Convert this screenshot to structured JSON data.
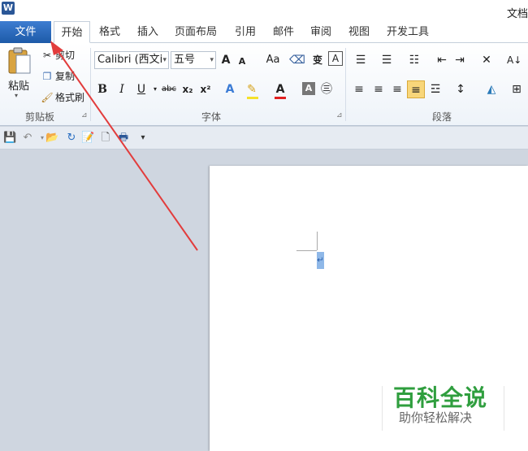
{
  "window": {
    "app_icon": "W",
    "title_partial": "文档"
  },
  "tabs": [
    "文件",
    "开始",
    "格式",
    "插入",
    "页面布局",
    "引用",
    "邮件",
    "审阅",
    "视图",
    "开发工具"
  ],
  "clipboard": {
    "paste": "粘贴",
    "cut": "剪切",
    "copy": "复制",
    "format_painter": "格式刷",
    "label": "剪贴板"
  },
  "font": {
    "name": "Calibri (西文i",
    "size": "五号",
    "label": "字体",
    "grow": "A",
    "shrink": "A",
    "case": "Aa",
    "bold": "B",
    "italic": "I",
    "underline": "U",
    "strike": "abc",
    "sub": "x₂",
    "sup": "x²",
    "color_a": "A",
    "highlight_a": "A"
  },
  "paragraph": {
    "label": "段落"
  },
  "watermark": {
    "title": "百科全说",
    "subtitle": "助你轻松解决"
  },
  "colors": {
    "file_tab": "#2b5eb3",
    "arrow": "#e23c3c",
    "watermark_green": "#2f9e3e"
  },
  "icons": [
    "word-icon",
    "paste-icon",
    "cut-icon",
    "copy-icon",
    "format-painter-icon",
    "save-icon",
    "undo-icon",
    "open-icon",
    "refresh-icon",
    "new-doc-icon",
    "print-preview-icon",
    "customize-qat-icon"
  ]
}
